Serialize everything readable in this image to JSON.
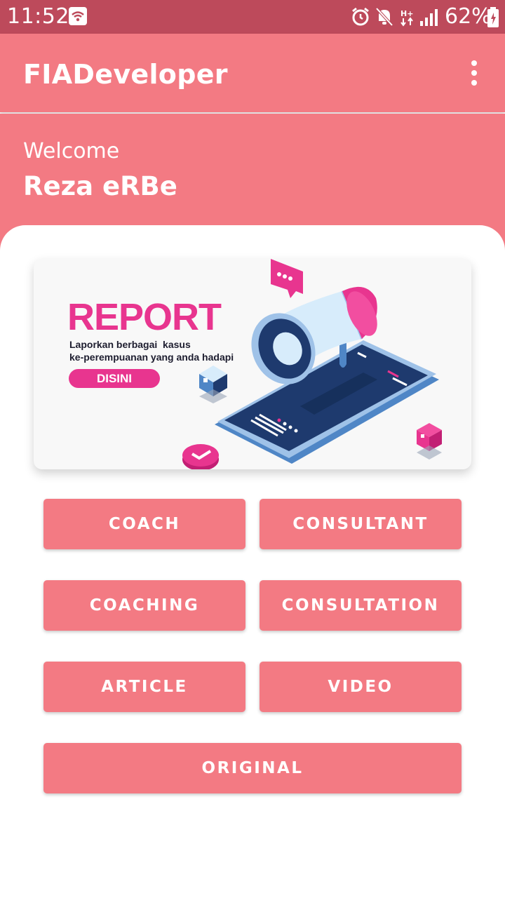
{
  "status_bar": {
    "time": "11:52",
    "battery": "62%",
    "icons": [
      "wifi-icon",
      "alarm-icon",
      "mute-icon",
      "data-arrows-icon",
      "signal-icon",
      "battery-icon"
    ]
  },
  "app_bar": {
    "title": "FIADeveloper",
    "menu_icon": "more-vert-icon"
  },
  "header": {
    "welcome": "Welcome",
    "username": "Reza eRBe"
  },
  "banner": {
    "title": "REPORT",
    "subtitle_line1": "Laporkan berbagai  kasus",
    "subtitle_line2": "ke-perempuanan yang anda hadapi",
    "button": "DISINI",
    "illustration": "megaphone-on-phone-illustration"
  },
  "menu": {
    "coach": "COACH",
    "consultant": "CONSULTANT",
    "coaching": "COACHING",
    "consultation": "CONSULTATION",
    "article": "ARTICLE",
    "video": "VIDEO",
    "original": "ORIGINAL"
  },
  "colors": {
    "status_bar": "#bd4a5b",
    "primary": "#f37a83",
    "accent_pink": "#e8358f",
    "navy": "#1e3a6e"
  }
}
